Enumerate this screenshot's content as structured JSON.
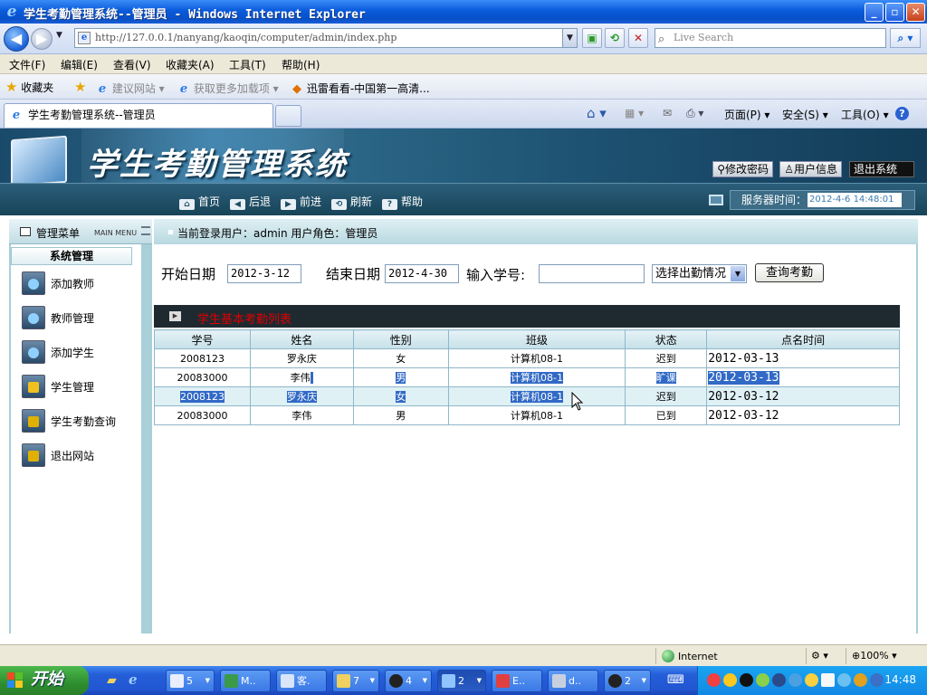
{
  "window": {
    "title": "学生考勤管理系统--管理员 - Windows Internet Explorer"
  },
  "addressbar": {
    "url": "http://127.0.0.1/nanyang/kaoqin/computer/admin/index.php",
    "search_placeholder": "Live Search"
  },
  "menubar": {
    "items": [
      "文件(F)",
      "编辑(E)",
      "查看(V)",
      "收藏夹(A)",
      "工具(T)",
      "帮助(H)"
    ]
  },
  "favbar": {
    "favorites": "收藏夹",
    "items": [
      "建议网站 ▾",
      "获取更多加载项 ▾",
      "迅雷看看-中国第一高清..."
    ]
  },
  "tabbar": {
    "tab_label": "学生考勤管理系统--管理员",
    "commands": {
      "page": "页面(P) ▾",
      "safety": "安全(S) ▾",
      "tools": "工具(O) ▾"
    }
  },
  "app": {
    "system_name": "学生考勤管理系统",
    "top_links": [
      "修改密码",
      "用户信息",
      "退出系统"
    ],
    "nav": [
      "首页",
      "后退",
      "前进",
      "刷新",
      "帮助"
    ],
    "server_time_label": "服务器时间：",
    "server_time": "2012-4-6 14:48:01",
    "menu_title": "管理菜单",
    "menu_subtitle": "MAIN MENU",
    "section_title": "系统管理",
    "menu_items": [
      "添加教师",
      "教师管理",
      "添加学生",
      "学生管理",
      "学生考勤查询",
      "退出网站"
    ],
    "login_info": "当前登录用户：admin  用户角色：管理员"
  },
  "filter": {
    "start_label": "开始日期",
    "start_value": "2012-3-12",
    "end_label": "结束日期",
    "end_value": "2012-4-30",
    "student_label": "输入学号:",
    "student_value": "",
    "select_value": "选择出勤情况",
    "button": "查询考勤"
  },
  "list": {
    "title": "学生基本考勤列表",
    "headers": [
      "学号",
      "姓名",
      "性别",
      "班级",
      "状态",
      "点名时间"
    ],
    "rows": [
      [
        "2008123",
        "罗永庆",
        "女",
        "计算机08-1",
        "迟到",
        "2012-03-13"
      ],
      [
        "20083000",
        "李伟",
        "男",
        "计算机08-1",
        "旷课",
        "2012-03-13"
      ],
      [
        "2008123",
        "罗永庆",
        "女",
        "计算机08-1",
        "迟到",
        "2012-03-12"
      ],
      [
        "20083000",
        "李伟",
        "男",
        "计算机08-1",
        "已到",
        "2012-03-12"
      ]
    ]
  },
  "statusbar": {
    "zone": "Internet",
    "zoom": "100%"
  },
  "taskbar": {
    "start": "开始",
    "buttons": [
      "5",
      "M..",
      "客.",
      "7",
      "4",
      "2",
      "E..",
      "d..",
      "2"
    ],
    "clock": "14:48"
  }
}
